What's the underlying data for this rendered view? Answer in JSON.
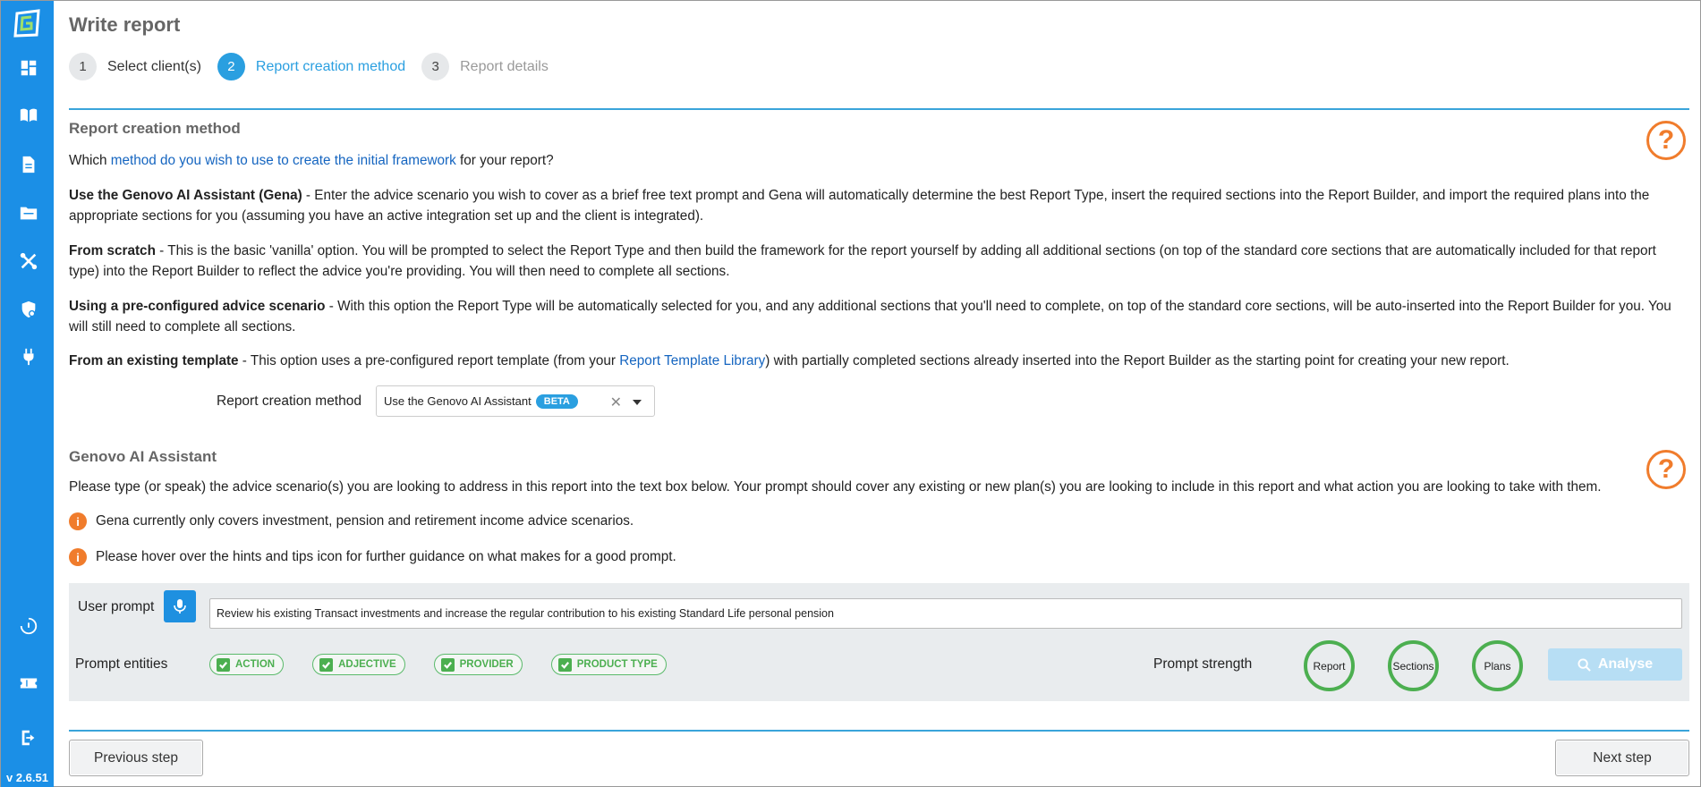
{
  "app": {
    "version": "v 2.6.51"
  },
  "colors": {
    "sidebar": "#1b8fe6",
    "accent": "#2a9fe0",
    "help": "#f07c2c",
    "entity": "#4caf50"
  },
  "sidebar": {
    "items": [
      {
        "icon": "dashboard-icon"
      },
      {
        "icon": "book-icon"
      },
      {
        "icon": "document-icon"
      },
      {
        "icon": "folder-icon"
      },
      {
        "icon": "tools-icon"
      },
      {
        "icon": "shield-icon"
      },
      {
        "icon": "plug-icon"
      },
      {
        "icon": "help-circle-icon"
      },
      {
        "icon": "ticket-icon"
      },
      {
        "icon": "logout-icon"
      }
    ]
  },
  "page": {
    "title": "Write report"
  },
  "stepper": [
    {
      "num": "1",
      "label": "Select client(s)"
    },
    {
      "num": "2",
      "label": "Report creation method"
    },
    {
      "num": "3",
      "label": "Report details"
    }
  ],
  "method_section": {
    "title": "Report creation method",
    "question_pre": "Which ",
    "question_link": "method do you wish to use to create the initial framework",
    "question_post": " for your report?",
    "options": [
      {
        "bold": "Use the Genovo AI Assistant (Gena)",
        "text": " - Enter the advice scenario you wish to cover as a brief free text prompt and Gena will automatically determine the best Report Type, insert the required sections into the Report Builder, and import the required plans into the appropriate sections for you (assuming you have an active integration set up and the client is integrated)."
      },
      {
        "bold": "From scratch",
        "text": " - This is the basic 'vanilla' option. You will be prompted to select the Report Type and then build the framework for the report yourself by adding all additional sections (on top of the standard core sections that are automatically included for that report type) into the Report Builder to reflect the advice you're providing. You will then need to complete all sections."
      },
      {
        "bold": "Using a pre-configured advice scenario",
        "text": " - With this option the Report Type will be automatically selected for you, and any additional sections that you'll need to complete, on top of the standard core sections, will be auto-inserted into the Report Builder for you. You will still need to complete all sections."
      }
    ],
    "template_bold": "From an existing template",
    "template_pre": " - This option uses a pre-configured report template (from your ",
    "template_link": "Report Template Library",
    "template_post": ") with partially completed sections already inserted into the Report Builder as the starting point for creating your new report.",
    "select_label": "Report creation method",
    "select_value": "Use the Genovo AI Assistant",
    "select_badge": "BETA",
    "help_glyph": "?"
  },
  "gena_section": {
    "title": "Genovo AI Assistant",
    "intro": "Please type (or speak) the advice scenario(s) you are looking to address in this report into the text box below. Your prompt should cover any existing or new plan(s) you are looking to include in this report and what action you are looking to take with them.",
    "notes": [
      "Gena currently only covers investment, pension and retirement income advice scenarios.",
      "Please hover over the hints and tips icon for further guidance on what makes for a good prompt."
    ],
    "help_glyph": "?",
    "info_glyph": "i"
  },
  "prompt_panel": {
    "user_prompt_label": "User prompt",
    "prompt_value": "Review his existing Transact investments and increase the regular contribution to his existing Standard Life personal pension",
    "entities_label": "Prompt entities",
    "entities": [
      "ACTION",
      "ADJECTIVE",
      "PROVIDER",
      "PRODUCT TYPE"
    ],
    "strength_label": "Prompt strength",
    "strength_indicators": [
      "Report",
      "Sections",
      "Plans"
    ],
    "analyse_label": "Analyse"
  },
  "footer": {
    "previous_label": "Previous step",
    "next_label": "Next step"
  }
}
